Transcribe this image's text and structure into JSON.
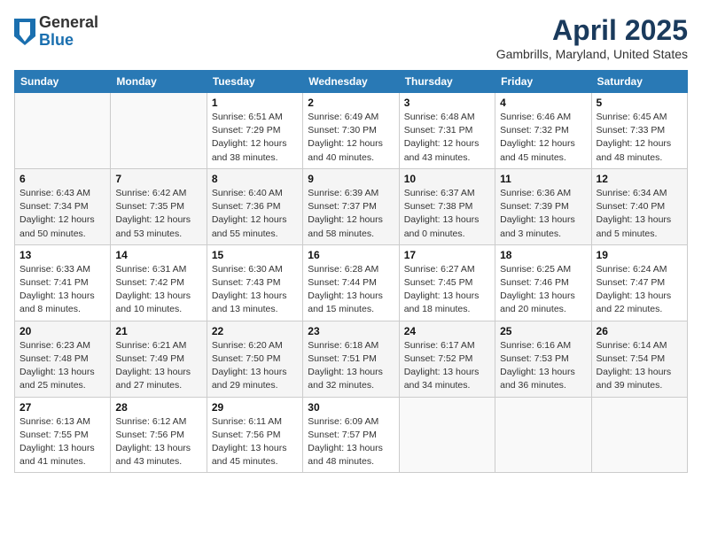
{
  "header": {
    "logo_general": "General",
    "logo_blue": "Blue",
    "title": "April 2025",
    "location": "Gambrills, Maryland, United States"
  },
  "days_of_week": [
    "Sunday",
    "Monday",
    "Tuesday",
    "Wednesday",
    "Thursday",
    "Friday",
    "Saturday"
  ],
  "weeks": [
    [
      {
        "day": "",
        "info": ""
      },
      {
        "day": "",
        "info": ""
      },
      {
        "day": "1",
        "info": "Sunrise: 6:51 AM\nSunset: 7:29 PM\nDaylight: 12 hours\nand 38 minutes."
      },
      {
        "day": "2",
        "info": "Sunrise: 6:49 AM\nSunset: 7:30 PM\nDaylight: 12 hours\nand 40 minutes."
      },
      {
        "day": "3",
        "info": "Sunrise: 6:48 AM\nSunset: 7:31 PM\nDaylight: 12 hours\nand 43 minutes."
      },
      {
        "day": "4",
        "info": "Sunrise: 6:46 AM\nSunset: 7:32 PM\nDaylight: 12 hours\nand 45 minutes."
      },
      {
        "day": "5",
        "info": "Sunrise: 6:45 AM\nSunset: 7:33 PM\nDaylight: 12 hours\nand 48 minutes."
      }
    ],
    [
      {
        "day": "6",
        "info": "Sunrise: 6:43 AM\nSunset: 7:34 PM\nDaylight: 12 hours\nand 50 minutes."
      },
      {
        "day": "7",
        "info": "Sunrise: 6:42 AM\nSunset: 7:35 PM\nDaylight: 12 hours\nand 53 minutes."
      },
      {
        "day": "8",
        "info": "Sunrise: 6:40 AM\nSunset: 7:36 PM\nDaylight: 12 hours\nand 55 minutes."
      },
      {
        "day": "9",
        "info": "Sunrise: 6:39 AM\nSunset: 7:37 PM\nDaylight: 12 hours\nand 58 minutes."
      },
      {
        "day": "10",
        "info": "Sunrise: 6:37 AM\nSunset: 7:38 PM\nDaylight: 13 hours\nand 0 minutes."
      },
      {
        "day": "11",
        "info": "Sunrise: 6:36 AM\nSunset: 7:39 PM\nDaylight: 13 hours\nand 3 minutes."
      },
      {
        "day": "12",
        "info": "Sunrise: 6:34 AM\nSunset: 7:40 PM\nDaylight: 13 hours\nand 5 minutes."
      }
    ],
    [
      {
        "day": "13",
        "info": "Sunrise: 6:33 AM\nSunset: 7:41 PM\nDaylight: 13 hours\nand 8 minutes."
      },
      {
        "day": "14",
        "info": "Sunrise: 6:31 AM\nSunset: 7:42 PM\nDaylight: 13 hours\nand 10 minutes."
      },
      {
        "day": "15",
        "info": "Sunrise: 6:30 AM\nSunset: 7:43 PM\nDaylight: 13 hours\nand 13 minutes."
      },
      {
        "day": "16",
        "info": "Sunrise: 6:28 AM\nSunset: 7:44 PM\nDaylight: 13 hours\nand 15 minutes."
      },
      {
        "day": "17",
        "info": "Sunrise: 6:27 AM\nSunset: 7:45 PM\nDaylight: 13 hours\nand 18 minutes."
      },
      {
        "day": "18",
        "info": "Sunrise: 6:25 AM\nSunset: 7:46 PM\nDaylight: 13 hours\nand 20 minutes."
      },
      {
        "day": "19",
        "info": "Sunrise: 6:24 AM\nSunset: 7:47 PM\nDaylight: 13 hours\nand 22 minutes."
      }
    ],
    [
      {
        "day": "20",
        "info": "Sunrise: 6:23 AM\nSunset: 7:48 PM\nDaylight: 13 hours\nand 25 minutes."
      },
      {
        "day": "21",
        "info": "Sunrise: 6:21 AM\nSunset: 7:49 PM\nDaylight: 13 hours\nand 27 minutes."
      },
      {
        "day": "22",
        "info": "Sunrise: 6:20 AM\nSunset: 7:50 PM\nDaylight: 13 hours\nand 29 minutes."
      },
      {
        "day": "23",
        "info": "Sunrise: 6:18 AM\nSunset: 7:51 PM\nDaylight: 13 hours\nand 32 minutes."
      },
      {
        "day": "24",
        "info": "Sunrise: 6:17 AM\nSunset: 7:52 PM\nDaylight: 13 hours\nand 34 minutes."
      },
      {
        "day": "25",
        "info": "Sunrise: 6:16 AM\nSunset: 7:53 PM\nDaylight: 13 hours\nand 36 minutes."
      },
      {
        "day": "26",
        "info": "Sunrise: 6:14 AM\nSunset: 7:54 PM\nDaylight: 13 hours\nand 39 minutes."
      }
    ],
    [
      {
        "day": "27",
        "info": "Sunrise: 6:13 AM\nSunset: 7:55 PM\nDaylight: 13 hours\nand 41 minutes."
      },
      {
        "day": "28",
        "info": "Sunrise: 6:12 AM\nSunset: 7:56 PM\nDaylight: 13 hours\nand 43 minutes."
      },
      {
        "day": "29",
        "info": "Sunrise: 6:11 AM\nSunset: 7:56 PM\nDaylight: 13 hours\nand 45 minutes."
      },
      {
        "day": "30",
        "info": "Sunrise: 6:09 AM\nSunset: 7:57 PM\nDaylight: 13 hours\nand 48 minutes."
      },
      {
        "day": "",
        "info": ""
      },
      {
        "day": "",
        "info": ""
      },
      {
        "day": "",
        "info": ""
      }
    ]
  ]
}
